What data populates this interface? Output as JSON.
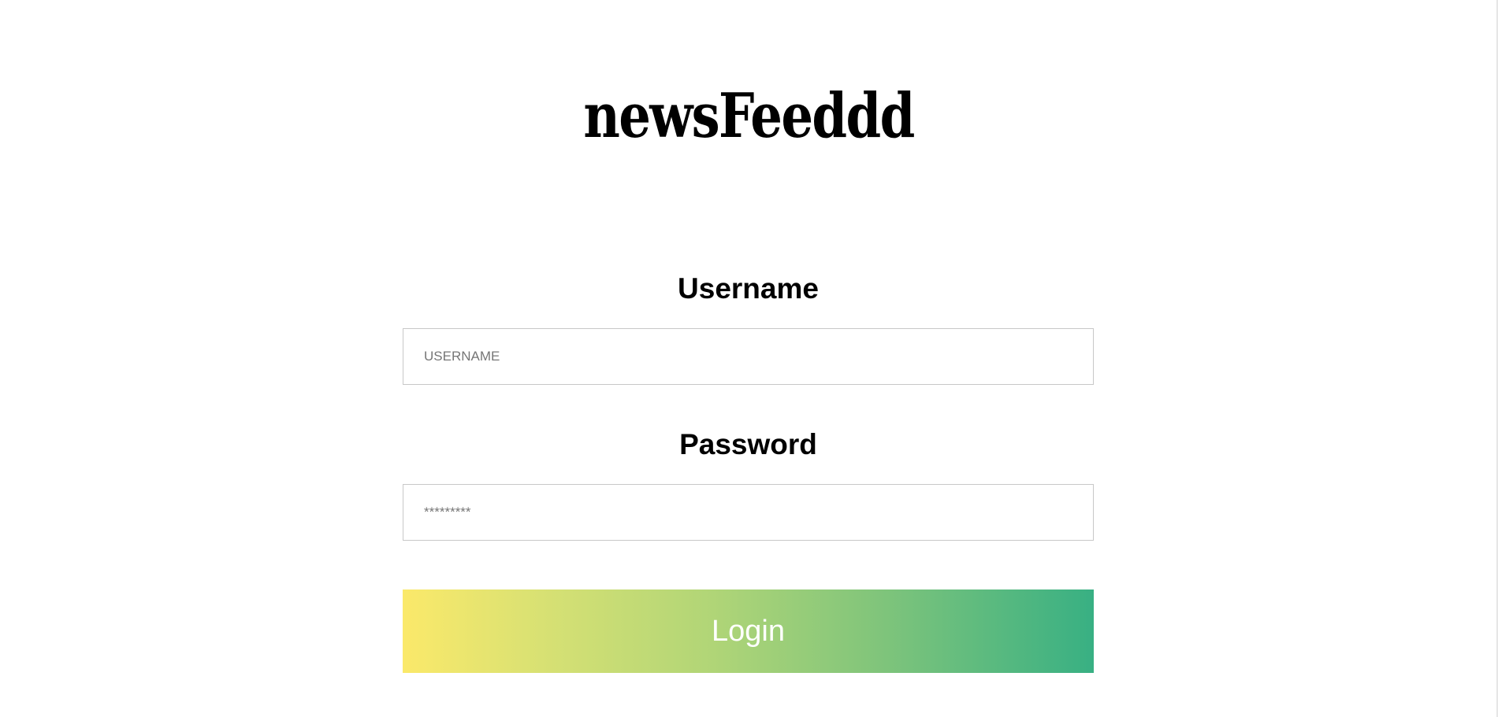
{
  "app": {
    "logo_text": "newsFeeddd"
  },
  "login_form": {
    "username_label": "Username",
    "username_placeholder": "USERNAME",
    "password_label": "Password",
    "password_placeholder": "*********",
    "submit_label": "Login"
  },
  "colors": {
    "button_gradient_start": "#fbe96a",
    "button_gradient_end": "#38b083",
    "button_text": "#ffffff",
    "input_border": "#c8c8c8"
  }
}
